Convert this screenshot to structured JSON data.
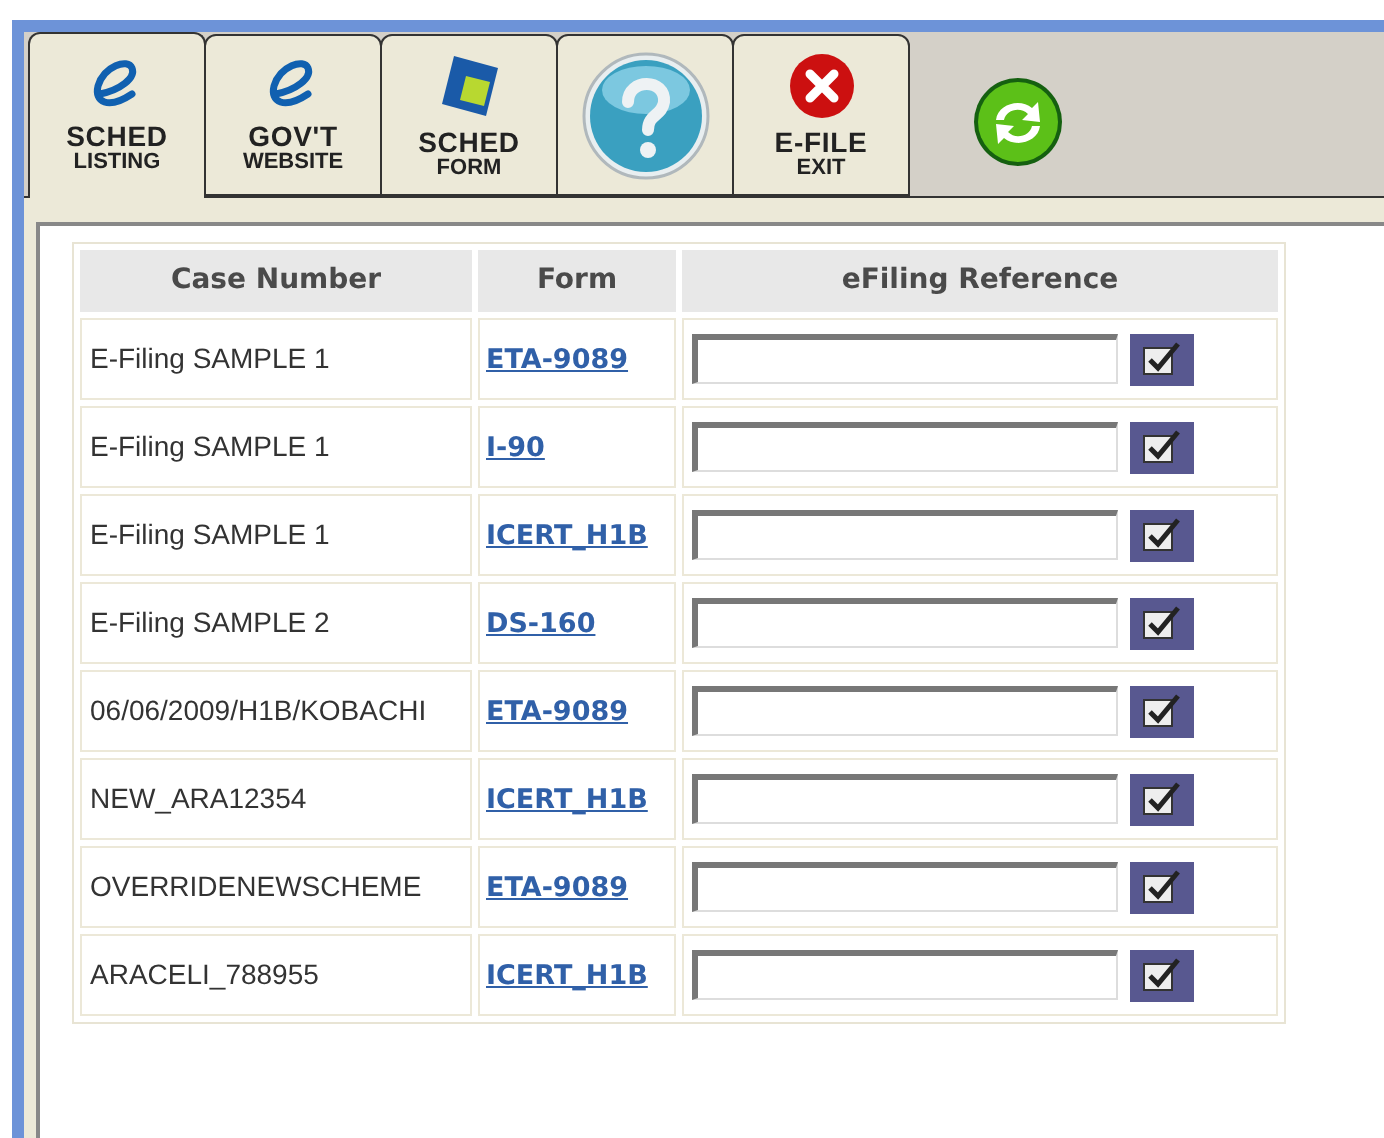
{
  "tabs": [
    {
      "kind": "e-logo",
      "line1": "SCHED",
      "line2": "LISTING",
      "selected": true
    },
    {
      "kind": "e-logo",
      "line1": "GOV'T",
      "line2": "WEBSITE",
      "selected": false
    },
    {
      "kind": "form",
      "line1": "SCHED",
      "line2": "FORM",
      "selected": false
    },
    {
      "kind": "help",
      "selected": false
    },
    {
      "kind": "exit",
      "line1": "E-FILE",
      "line2": "EXIT",
      "selected": false
    }
  ],
  "table": {
    "columns": [
      "Case Number",
      "Form",
      "eFiling Reference"
    ],
    "rows": [
      {
        "case": "E-Filing SAMPLE 1",
        "form": "ETA-9089"
      },
      {
        "case": "E-Filing SAMPLE 1",
        "form": "I-90"
      },
      {
        "case": "E-Filing SAMPLE 1",
        "form": "ICERT_H1B"
      },
      {
        "case": "E-Filing SAMPLE 2",
        "form": "DS-160"
      },
      {
        "case": "06/06/2009/H1B/KOBACHI",
        "form": "ETA-9089"
      },
      {
        "case": "NEW_ARA12354",
        "form": "ICERT_H1B"
      },
      {
        "case": "OVERRIDENEWSCHEME",
        "form": "ETA-9089"
      },
      {
        "case": "ARACELI_788955",
        "form": "ICERT_H1B"
      }
    ]
  }
}
